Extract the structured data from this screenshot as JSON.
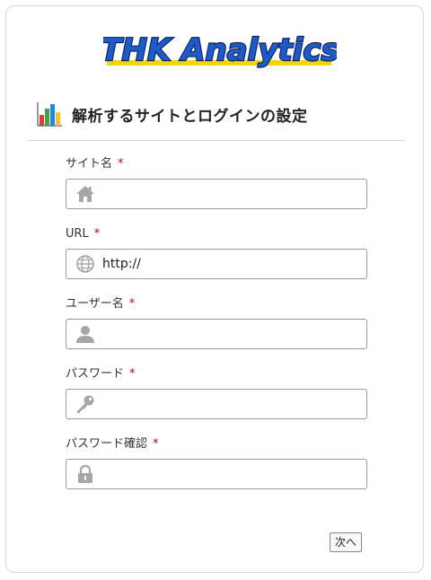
{
  "logo": {
    "text": "THK Analytics",
    "colors": {
      "fill": "#1e5bc6",
      "outline": "#0a1f5c",
      "underline": "#f2d400"
    }
  },
  "header": {
    "icon": "bar-chart-icon",
    "title": "解析するサイトとログインの設定"
  },
  "form": {
    "required_mark": "*",
    "fields": [
      {
        "label": "サイト名",
        "icon": "home-icon",
        "value": ""
      },
      {
        "label": "URL",
        "icon": "globe-icon",
        "value": "http://"
      },
      {
        "label": "ユーザー名",
        "icon": "user-icon",
        "value": ""
      },
      {
        "label": "パスワード",
        "icon": "key-icon",
        "value": ""
      },
      {
        "label": "パスワード確認",
        "icon": "lock-icon",
        "value": ""
      }
    ],
    "next_label": "次へ"
  },
  "colors": {
    "required": "#c00000",
    "input_border": "#9a9a9a",
    "icon_gray": "#a6a6a6"
  }
}
